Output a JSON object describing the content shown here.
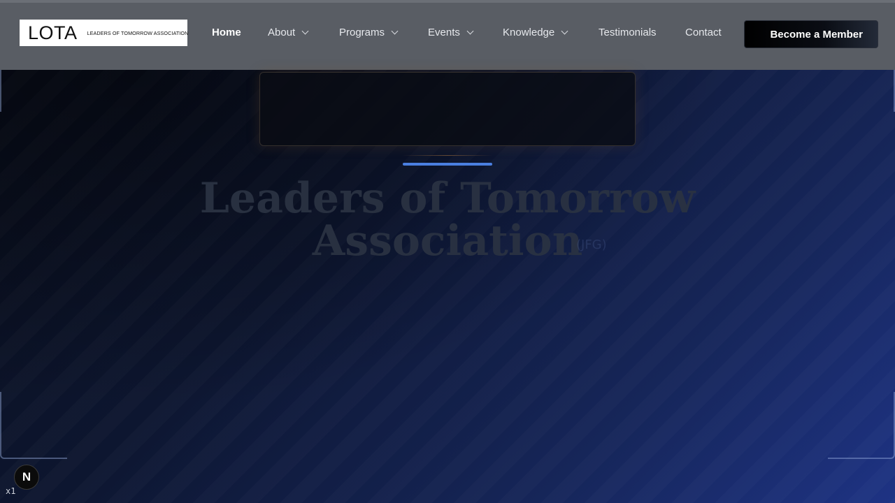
{
  "header": {
    "logo": {
      "mark": "LOTA",
      "subtitle": "LEADERS OF TOMORROW ASSOCIATION"
    },
    "nav": [
      {
        "label": "Home",
        "active": true,
        "has_dropdown": false
      },
      {
        "label": "About",
        "active": false,
        "has_dropdown": true
      },
      {
        "label": "Programs",
        "active": false,
        "has_dropdown": true
      },
      {
        "label": "Events",
        "active": false,
        "has_dropdown": true
      },
      {
        "label": "Knowledge",
        "active": false,
        "has_dropdown": true
      },
      {
        "label": "Testimonials",
        "active": false,
        "has_dropdown": false
      },
      {
        "label": "Contact",
        "active": false,
        "has_dropdown": false
      }
    ],
    "cta_label": "Become a Member"
  },
  "hero": {
    "title": "Leaders of Tomorrow Association",
    "ghost_text": "(JFG)",
    "accent_color": "#4a7fe0"
  },
  "dev_indicator": {
    "icon": "nextjs-icon",
    "badge_letter": "N",
    "scale_text": "x1"
  },
  "colors": {
    "header_bg": "#595d64",
    "background_start": "#080c18",
    "background_end": "#1e3384"
  }
}
